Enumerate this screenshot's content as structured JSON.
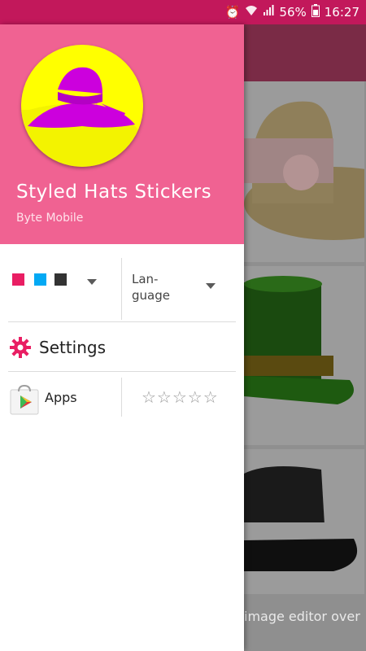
{
  "status_bar": {
    "battery_percent": "56%",
    "time": "16:27",
    "icons": [
      "alarm-icon",
      "wifi-icon",
      "signal-icon",
      "battery-icon"
    ]
  },
  "drawer": {
    "title": "Styled Hats Stickers",
    "subtitle": "Byte Mobile",
    "colors": {
      "header": "#f06292",
      "accent": "#e91e63",
      "logo_bg": "#ffff00",
      "logo_hat": "#cc00dd"
    },
    "theme_swatches": [
      "#e91e63",
      "#03a9f4",
      "#333333"
    ],
    "language_label": "Lan-\nguage",
    "settings_label": "Settings",
    "apps_label": "Apps",
    "rating_stars": "☆☆☆☆☆"
  },
  "background": {
    "footer_text": "image editor over"
  }
}
